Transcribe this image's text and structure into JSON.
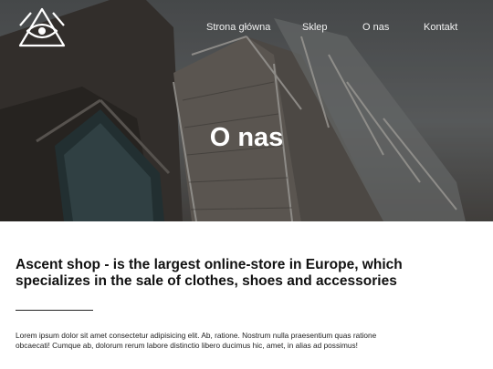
{
  "logo": {
    "icon": "eye-triangle-logo-icon"
  },
  "nav": {
    "items": [
      {
        "label": "Strona główna"
      },
      {
        "label": "Sklep"
      },
      {
        "label": "O nas"
      },
      {
        "label": "Kontakt"
      }
    ]
  },
  "hero": {
    "title": "O nas"
  },
  "main": {
    "headline": "Ascent shop - is the largest online-store in Europe, which specializes in the sale of clothes, shoes and accessories",
    "paragraph": "Lorem ipsum dolor sit amet consectetur adipisicing elit. Ab, ratione. Nostrum nulla praesentium quas ratione obcaecati! Cumque ab, dolorum rerum labore distinctio libero ducimus hic, amet, in alias ad possimus!"
  }
}
